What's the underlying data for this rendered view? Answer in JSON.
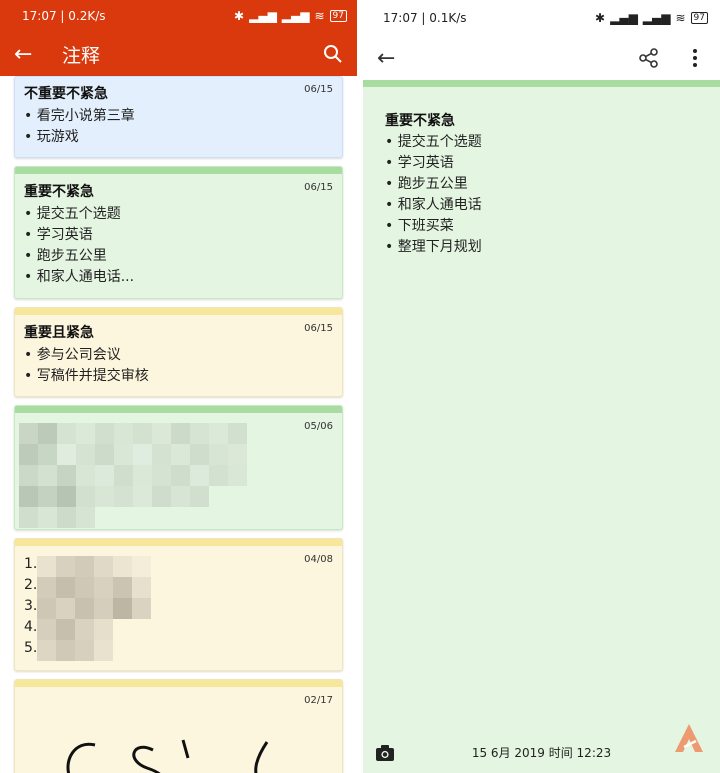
{
  "left": {
    "status": {
      "time": "17:07 | 0.2K/s",
      "battery": "97"
    },
    "appbar": {
      "title": "注释"
    },
    "notes": [
      {
        "title": "不重要不紧急",
        "date": "06/15",
        "color": "blue",
        "lines": [
          "看完小说第三章",
          "玩游戏"
        ]
      },
      {
        "title": "重要不紧急",
        "date": "06/15",
        "color": "green",
        "lines": [
          "提交五个选题",
          "学习英语",
          "跑步五公里",
          "和家人通电话..."
        ]
      },
      {
        "title": "重要且紧急",
        "date": "06/15",
        "color": "yellow",
        "lines": [
          "参与公司会议",
          "写稿件并提交审核"
        ]
      },
      {
        "date": "05/06",
        "color": "green"
      },
      {
        "date": "04/08",
        "color": "yellow",
        "numbers": [
          "1.",
          "2.",
          "3.",
          "4.",
          "5."
        ]
      },
      {
        "date": "02/17",
        "color": "yellow"
      }
    ]
  },
  "right": {
    "status": {
      "time": "17:07 | 0.1K/s",
      "battery": "97"
    },
    "note": {
      "title": "重要不紧急",
      "lines": [
        "提交五个选题",
        "学习英语",
        "跑步五公里",
        "和家人通电话",
        "下班买菜",
        "整理下月规划"
      ]
    },
    "footer": {
      "timestamp": "15 6月 2019 时间 12:23"
    }
  },
  "colors": {
    "accent": "#d9390c",
    "green_note": "#e4f6e2",
    "blue_note": "#e3effc",
    "yellow_note": "#fdf6de"
  }
}
